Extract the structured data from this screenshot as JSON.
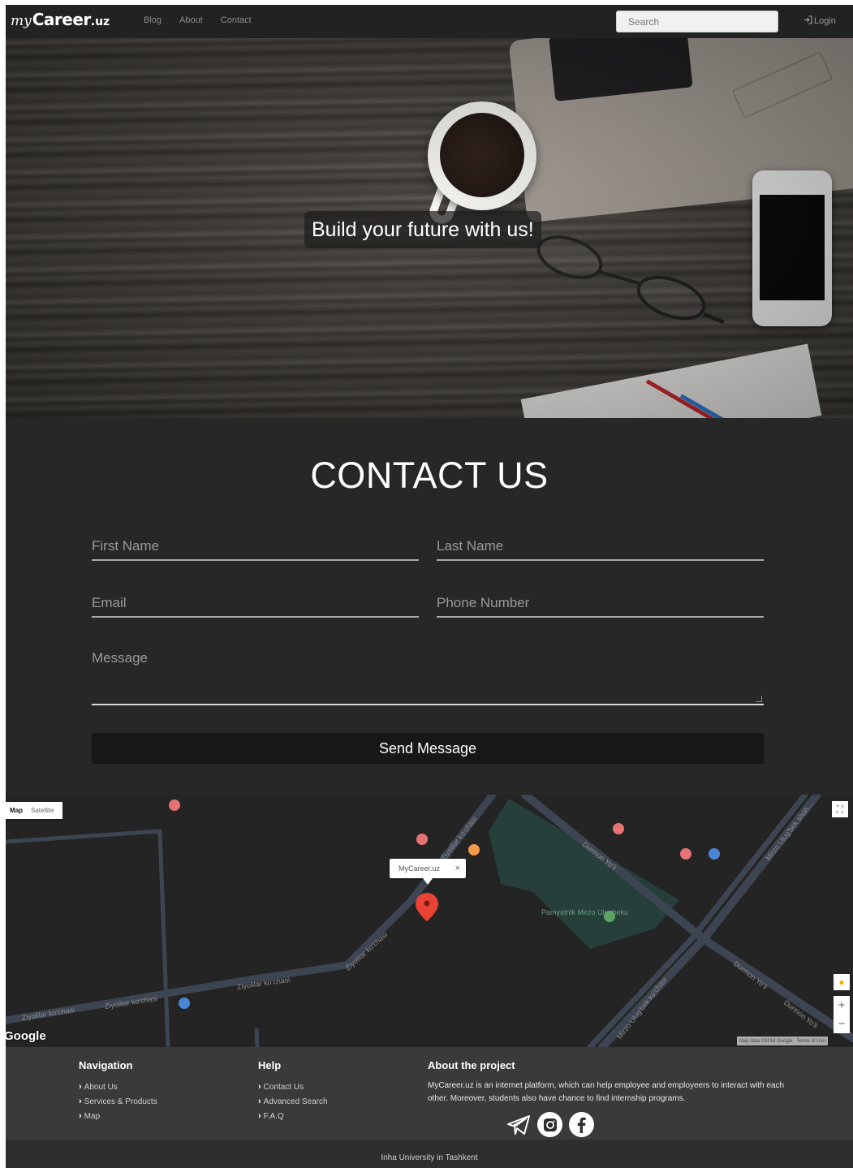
{
  "navbar": {
    "brand_my": "my",
    "brand_career": "Career",
    "brand_tld": ".uz",
    "links": [
      "Blog",
      "About",
      "Contact"
    ],
    "search_placeholder": "Search",
    "login_label": "Login"
  },
  "hero": {
    "tagline": "Build your future with us!"
  },
  "contact": {
    "title": "CONTACT US",
    "first_name_placeholder": "First Name",
    "last_name_placeholder": "Last Name",
    "email_placeholder": "Email",
    "phone_placeholder": "Phone Number",
    "message_placeholder": "Message",
    "send_label": "Send Message"
  },
  "map": {
    "type_map": "Map",
    "type_satellite": "Satellite",
    "info_window_name": "MyCareer.uz",
    "info_window_close": "×",
    "place_label": "Pamyatnik Mirzo Ulugbeku",
    "streets": [
      "Ziyolilar ko'chasi",
      "Ziyolilar ko'chasi",
      "Ziyolilar ko'chasi",
      "Ziyolilar ko'chasi",
      "Durmon Yo'li",
      "Durmon Yo'li",
      "Durmon Yo'li",
      "Mirzo Ulug'bek shoh...",
      "Mirzo Ulug'bek ko'chasi",
      "Ziyolilar ko'chasi"
    ],
    "google_logo": "Google",
    "attribution": "Map data ©2018 Google",
    "terms": "Terms of Use",
    "zoom_in": "+",
    "zoom_out": "−",
    "colors": {
      "background": "#242424",
      "roads": "#3d4552",
      "park": "#263f3a",
      "marker": "#ea4335"
    }
  },
  "footer": {
    "navigation_title": "Navigation",
    "navigation_items": [
      "About Us",
      "Services & Products",
      "Map"
    ],
    "help_title": "Help",
    "help_items": [
      "Contact Us",
      "Advanced Search",
      "F.A.Q"
    ],
    "about_title": "About the project",
    "about_text": "MyCareer.uz is an internet platform, which can help employee and employeers to interact with each other. Moreover, students also have chance to find internship programs.",
    "social_icons": [
      "telegram-icon",
      "instagram-icon",
      "facebook-icon"
    ],
    "bottom_text": "Inha University in Tashkent"
  }
}
